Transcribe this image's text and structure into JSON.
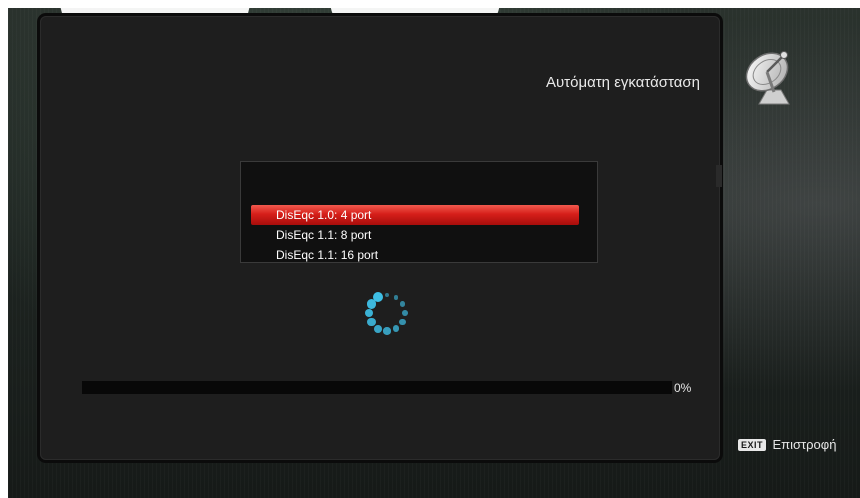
{
  "header": {
    "title": "Αυτόματη εγκατάσταση",
    "icon": "satellite-dish-icon"
  },
  "diseqc_list": {
    "items": [
      {
        "label": "DisEqc 1.0: 4 port",
        "selected": true
      },
      {
        "label": "DisEqc 1.1: 8 port",
        "selected": false
      },
      {
        "label": "DisEqc 1.1: 16 port",
        "selected": false
      }
    ]
  },
  "progress": {
    "value": 0,
    "label": "0%"
  },
  "footer": {
    "exit_key": "EXIT",
    "exit_label": "Επιστροφή"
  },
  "colors": {
    "accent": "#3fc1e8",
    "selection": "#d61f1a",
    "panel": "#1e1e1e"
  },
  "spinner": {
    "icon": "loading-spinner-icon"
  }
}
